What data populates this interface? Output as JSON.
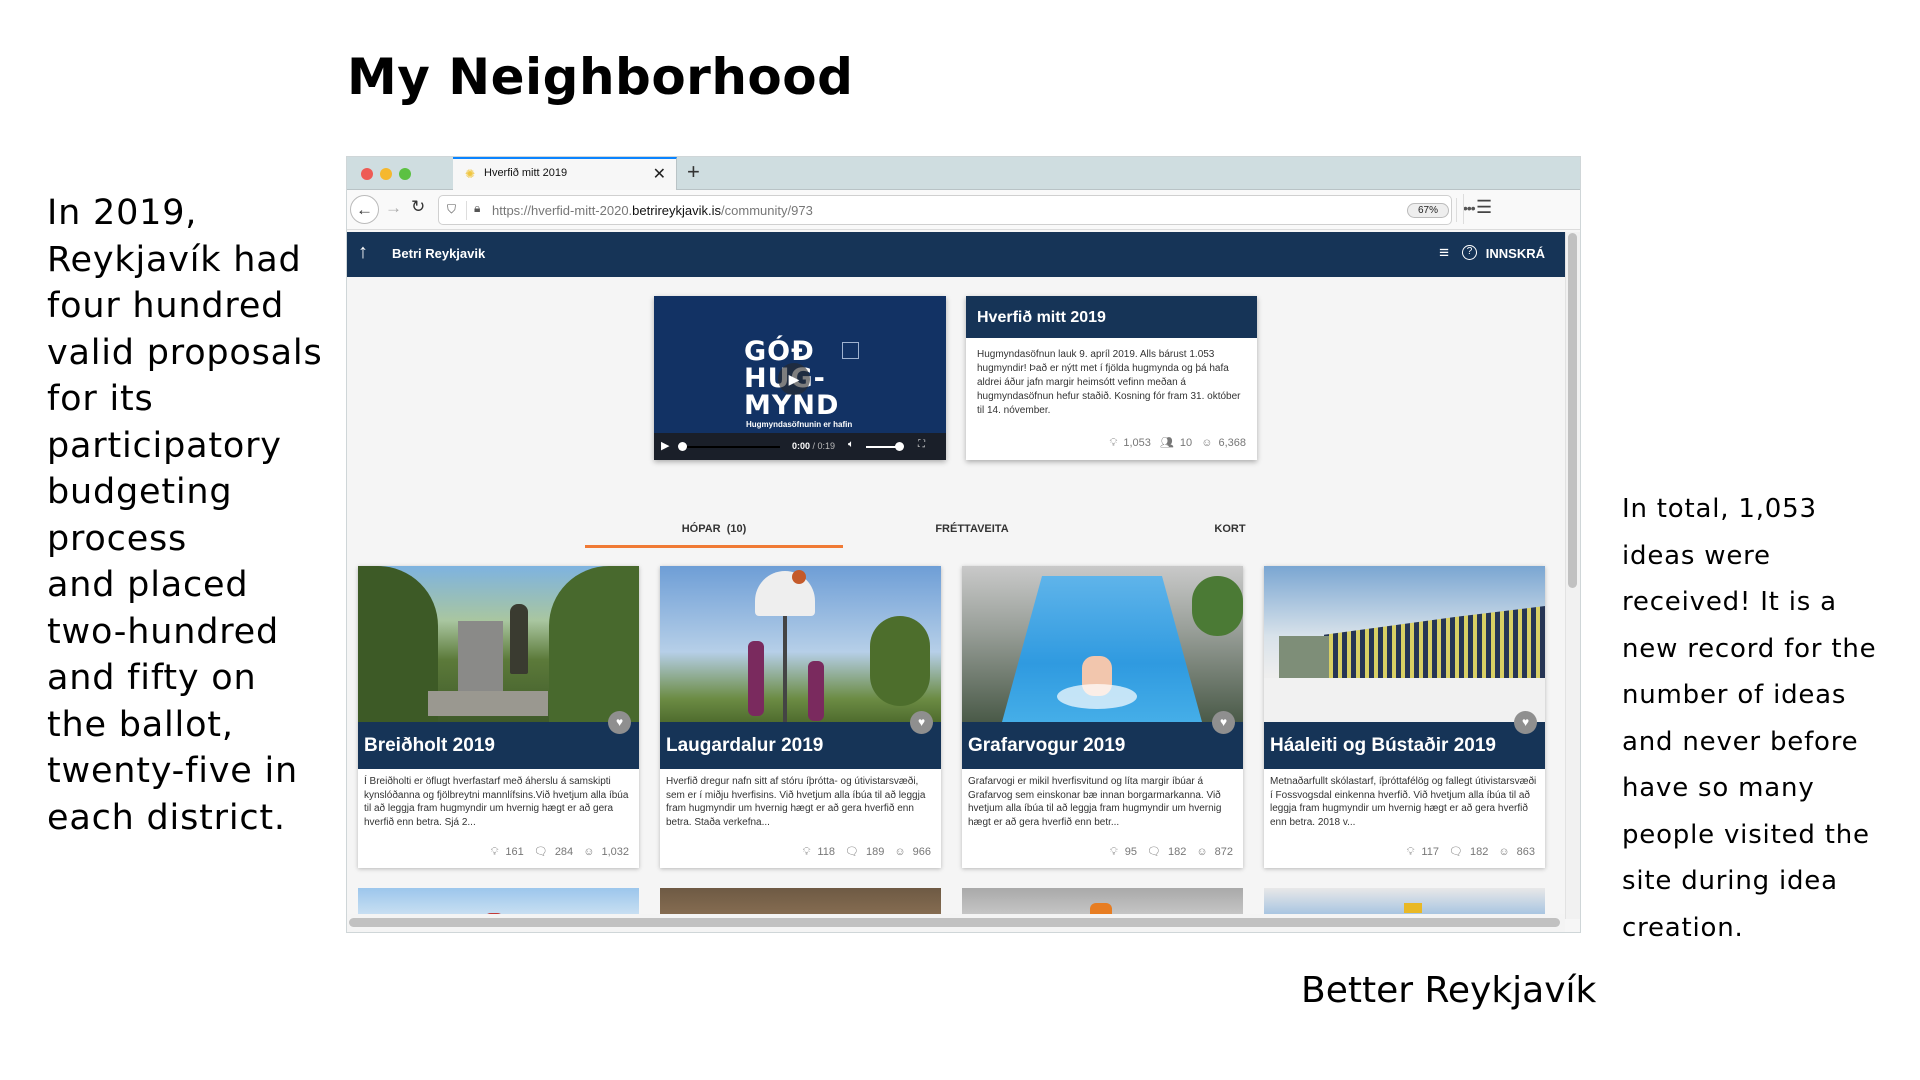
{
  "slide": {
    "title": "My Neighborhood",
    "left_text": "In 2019,\nReykjavík had\nfour hundred\nvalid proposals\nfor its\nparticipatory\nbudgeting\nprocess\nand placed\ntwo-hundred\nand fifty on\nthe ballot,\ntwenty-five in\neach district.",
    "right_text": "In total, 1,053\nideas were\nreceived! It is a\nnew record for the\nnumber of ideas\nand never before\nhave so many\npeople visited the\nsite during idea\ncreation.",
    "caption": "Better Reykjavík"
  },
  "browser": {
    "tab_title": "Hverfið mitt 2019",
    "tab_icon": "sun-favicon",
    "url_prefix": "https://hverfid-mitt-2020.",
    "url_domain": "betrireykjavik.is",
    "url_path": "/community/973",
    "zoom": "67%"
  },
  "site": {
    "brand": "Betri Reykjavik",
    "login_label": "INNSKRÁ",
    "video": {
      "logo_line1": "GÓÐ",
      "logo_line2": "HUG-",
      "logo_line3": "MYND",
      "subtitle": "Hugmyndasöfnunin er hafin",
      "current_time": "0:00",
      "duration": "/ 0:19",
      "progress": 0.0,
      "volume": 1.0
    },
    "info_card": {
      "title": "Hverfið mitt 2019",
      "body": "Hugmyndasöfnun lauk 9. apríl 2019. Alls bárust 1.053 hugmyndir! Það er nýtt met í fjölda hugmynda og þá hafa aldrei áður jafn margir heimsótt vefinn meðan á hugmyndasöfnun hefur staðið. Kosning fór fram 31. október til 14. nóvember.",
      "ideas": "1,053",
      "groups": "10",
      "users": "6,368"
    },
    "tabs": [
      {
        "label": "HÓPAR  (10)",
        "active": true
      },
      {
        "label": "FRÉTTAVEITA",
        "active": false
      },
      {
        "label": "KORT",
        "active": false
      }
    ],
    "cards": [
      {
        "title": "Breiðholt 2019",
        "desc": "Í Breiðholti er öflugt hverfastarf með áherslu á samskipti kynslóðanna og fjölbreytni mannlífsins.Við hvetjum alla íbúa til að leggja fram hugmyndir um hvernig hægt er að gera hverfið enn betra. Sjá 2...",
        "ideas": "161",
        "comments": "284",
        "users": "1,032"
      },
      {
        "title": "Laugardalur 2019",
        "desc": "Hverfið dregur nafn sitt af stóru íþrótta- og útivistarsvæði, sem er í miðju hverfisins. Við hvetjum alla íbúa til að leggja fram hugmyndir um hvernig hægt er að gera hverfið enn betra. Staða verkefna...",
        "ideas": "118",
        "comments": "189",
        "users": "966"
      },
      {
        "title": "Grafarvogur 2019",
        "desc": "Grafarvogi er mikil hverfisvitund og líta margir íbúar á Grafarvog sem einskonar bæ innan borgarmarkanna. Við hvetjum alla íbúa til að leggja fram hugmyndir um hvernig hægt er að gera hverfið enn betr...",
        "ideas": "95",
        "comments": "182",
        "users": "872"
      },
      {
        "title": "Háaleiti og Bústaðir 2019",
        "desc": "Metnaðarfullt skólastarf, íþróttafélög og fallegt útivistarsvæði í Fossvogsdal einkenna hverfið. Við hvetjum alla íbúa til að leggja fram hugmyndir um hvernig hægt er að gera hverfið enn betra. 2018 v...",
        "ideas": "117",
        "comments": "182",
        "users": "863"
      }
    ],
    "colors": {
      "navy": "#163457",
      "accent_orange": "#f07a35"
    }
  }
}
